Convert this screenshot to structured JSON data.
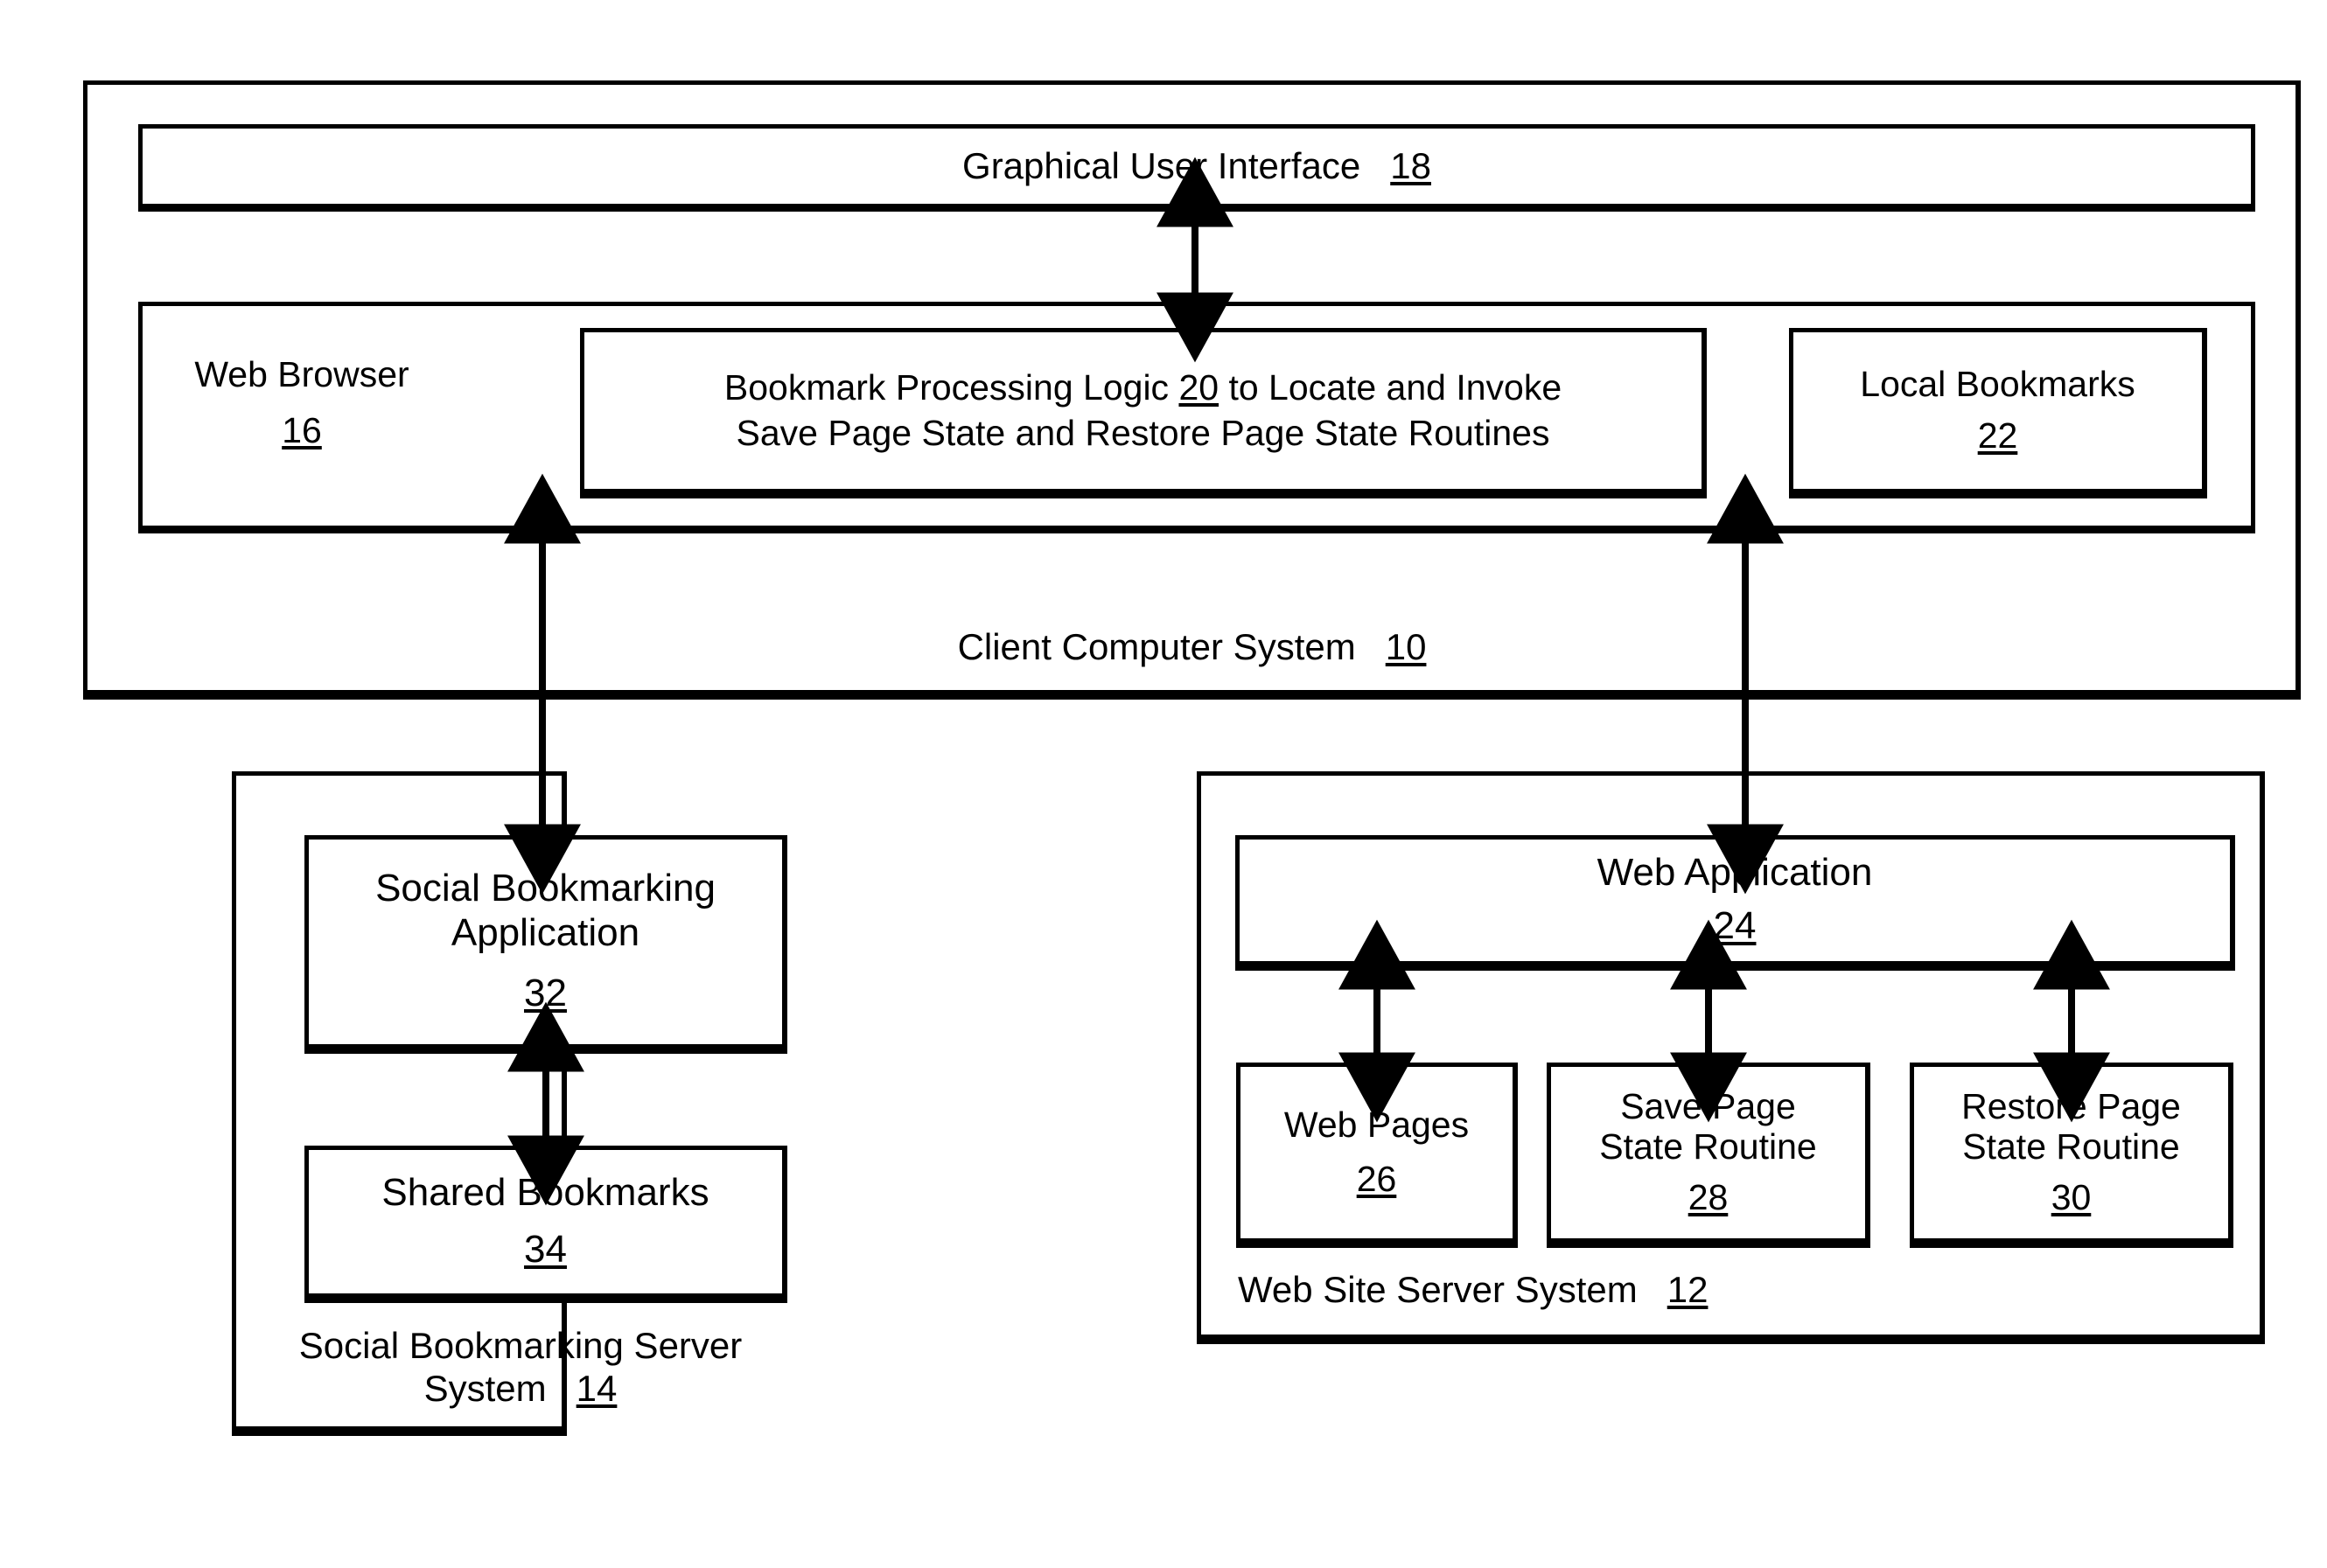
{
  "figure": {
    "type": "patent-block-diagram",
    "client_system": {
      "title": "Client Computer System",
      "ref": "10",
      "gui": {
        "title": "Graphical User Interface",
        "ref": "18"
      },
      "web_browser": {
        "title": "Web Browser",
        "ref": "16"
      },
      "bookmark_logic": {
        "line1_before": "Bookmark Processing Logic ",
        "line1_ref": "20",
        "line1_after": " to Locate and Invoke",
        "line2": "Save Page State and Restore Page State Routines"
      },
      "local_bookmarks": {
        "title": "Local Bookmarks",
        "ref": "22"
      }
    },
    "social_server": {
      "title": "Social Bookmarking Server\nSystem",
      "ref": "14",
      "application": {
        "title": "Social Bookmarking\nApplication",
        "ref": "32"
      },
      "shared_bookmarks": {
        "title": "Shared Bookmarks",
        "ref": "34"
      }
    },
    "web_server": {
      "title": "Web Site Server System",
      "ref": "12",
      "web_application": {
        "title": "Web Application",
        "ref": "24"
      },
      "web_pages": {
        "title": "Web Pages",
        "ref": "26"
      },
      "save_routine": {
        "title": "Save Page\nState Routine",
        "ref": "28"
      },
      "restore_routine": {
        "title": "Restore Page\nState Routine",
        "ref": "30"
      }
    },
    "connectors": [
      {
        "name": "gui-to-browser",
        "style": "double-headed"
      },
      {
        "name": "browser-to-social-bookmarking-application",
        "style": "double-headed"
      },
      {
        "name": "browser-to-web-application",
        "style": "double-headed"
      },
      {
        "name": "social-application-to-shared-bookmarks",
        "style": "double-headed"
      },
      {
        "name": "web-application-to-web-pages",
        "style": "double-headed"
      },
      {
        "name": "web-application-to-save-page-state-routine",
        "style": "double-headed"
      },
      {
        "name": "web-application-to-restore-page-state-routine",
        "style": "double-headed"
      }
    ],
    "colors": {
      "ink": "#000000",
      "paper": "#ffffff"
    }
  }
}
